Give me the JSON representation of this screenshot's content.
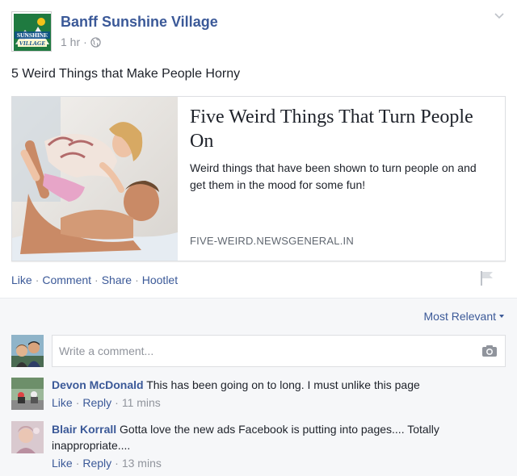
{
  "post": {
    "page_name": "Banff Sunshine Village",
    "time": "1 hr",
    "separator": "·",
    "text": "5 Weird Things that Make People Horny",
    "logo_text_top": "SUNSHINE",
    "logo_text_bottom": "VILLAGE"
  },
  "link": {
    "title": "Five Weird Things That Turn People On",
    "description": "Weird things that have been shown to turn people on and get them in the mood for some fun!",
    "domain": "FIVE-WEIRD.NEWSGENERAL.IN"
  },
  "actions": {
    "like": "Like",
    "comment": "Comment",
    "share": "Share",
    "hootlet": "Hootlet",
    "sep": "·"
  },
  "comments_section": {
    "sort_label": "Most Relevant",
    "input_placeholder": "Write a comment...",
    "comments": [
      {
        "author": "Devon McDonald",
        "text": "This has been going on to long. I must unlike this page",
        "like": "Like",
        "reply": "Reply",
        "time": "11 mins",
        "sep": "·"
      },
      {
        "author": "Blair Korrall",
        "text": "Gotta love the new ads Facebook is putting into pages.... Totally inappropriate....",
        "like": "Like",
        "reply": "Reply",
        "time": "13 mins",
        "sep": "·"
      }
    ]
  },
  "colors": {
    "link_blue": "#3b5998",
    "muted": "#90949c",
    "text": "#1d2129"
  }
}
